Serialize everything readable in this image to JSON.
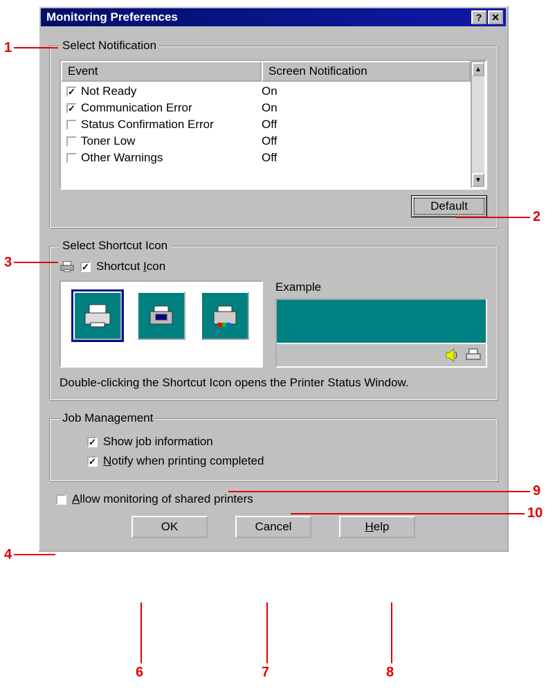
{
  "window": {
    "title": "Monitoring Preferences",
    "help_btn": "?",
    "close_btn": "✕"
  },
  "select_notification": {
    "legend": "Select Notification",
    "columns": {
      "event": "Event",
      "notification": "Screen Notification"
    },
    "rows": [
      {
        "label": "Not Ready",
        "checked": true,
        "value": "On"
      },
      {
        "label": "Communication Error",
        "checked": true,
        "value": "On"
      },
      {
        "label": "Status Confirmation Error",
        "checked": false,
        "value": "Off"
      },
      {
        "label": "Toner Low",
        "checked": false,
        "value": "Off"
      },
      {
        "label": "Other Warnings",
        "checked": false,
        "value": "Off"
      }
    ],
    "default_btn": "Default"
  },
  "select_shortcut": {
    "legend": "Select Shortcut Icon",
    "checkbox_label": "Shortcut Icon",
    "checkbox_checked": true,
    "example_label": "Example",
    "hint": "Double-clicking the Shortcut Icon opens the Printer Status Window."
  },
  "job_management": {
    "legend": "Job Management",
    "show_job": {
      "label": "Show job information",
      "checked": true
    },
    "notify_complete": {
      "label": "Notify when printing completed",
      "checked": true
    }
  },
  "shared_printers": {
    "label": "Allow monitoring of shared printers",
    "checked": false
  },
  "buttons": {
    "ok": "OK",
    "cancel": "Cancel",
    "help": "Help"
  },
  "callouts": {
    "1": "1",
    "2": "2",
    "3": "3",
    "4": "4",
    "6": "6",
    "7": "7",
    "8": "8",
    "9": "9",
    "10": "10"
  }
}
